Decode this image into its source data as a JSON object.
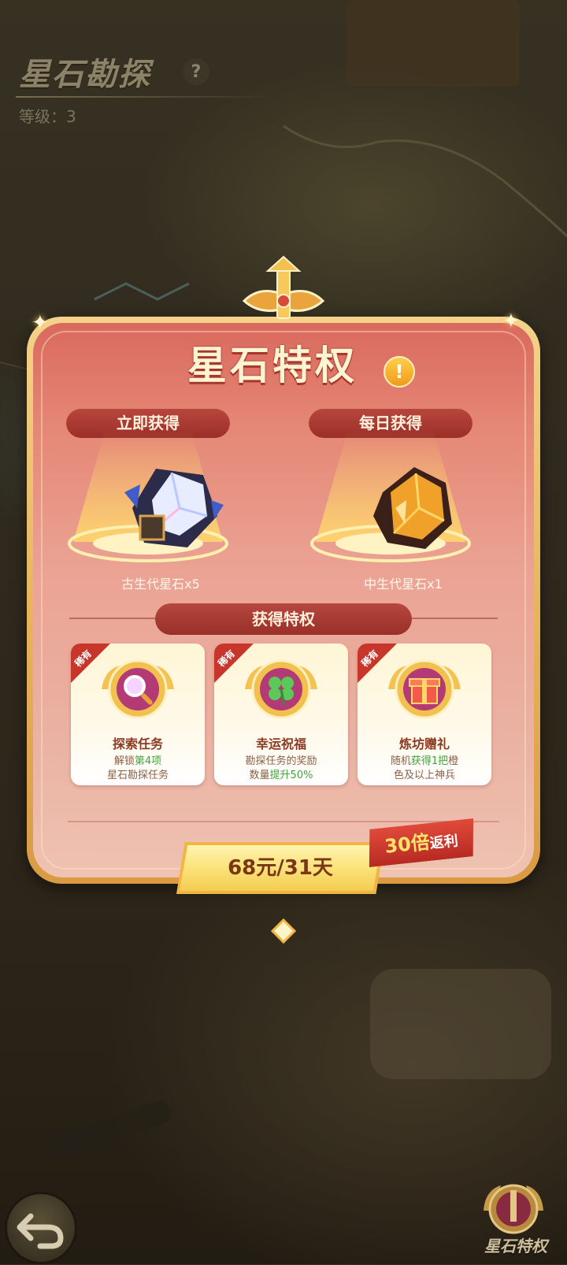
{
  "header": {
    "title": "星石勘探",
    "level_label": "等级：3"
  },
  "dialog": {
    "title": "星石特权",
    "instant": {
      "ribbon": "立即获得",
      "item": "古生代星石x5"
    },
    "daily": {
      "ribbon": "每日获得",
      "item": "中生代星石x1"
    },
    "section_title": "获得特权",
    "cards": [
      {
        "badge": "稀有",
        "title": "探索任务",
        "desc_parts": [
          "解锁",
          "第4项",
          "星石勘探任务"
        ],
        "icon": "magnifier-icon"
      },
      {
        "badge": "稀有",
        "title": "幸运祝福",
        "desc_parts": [
          "勘探任务的奖励",
          "数量",
          "提升50%"
        ],
        "icon": "clover-icon"
      },
      {
        "badge": "稀有",
        "title": "炼坊赠礼",
        "desc_parts": [
          "随机",
          "获得1把",
          "橙",
          "色及以上神兵"
        ],
        "icon": "gift-icon"
      }
    ],
    "price_label": "68元/31天",
    "bonus": {
      "num": "30倍",
      "text": "返利"
    }
  },
  "footer": {
    "corner_label": "星石特权"
  },
  "colors": {
    "panel_top": "#d9695d",
    "panel_bottom": "#efc2b2",
    "gold": "#f3cd51",
    "highlight_green": "#3fa53c",
    "bonus_red": "#e14a3a"
  }
}
